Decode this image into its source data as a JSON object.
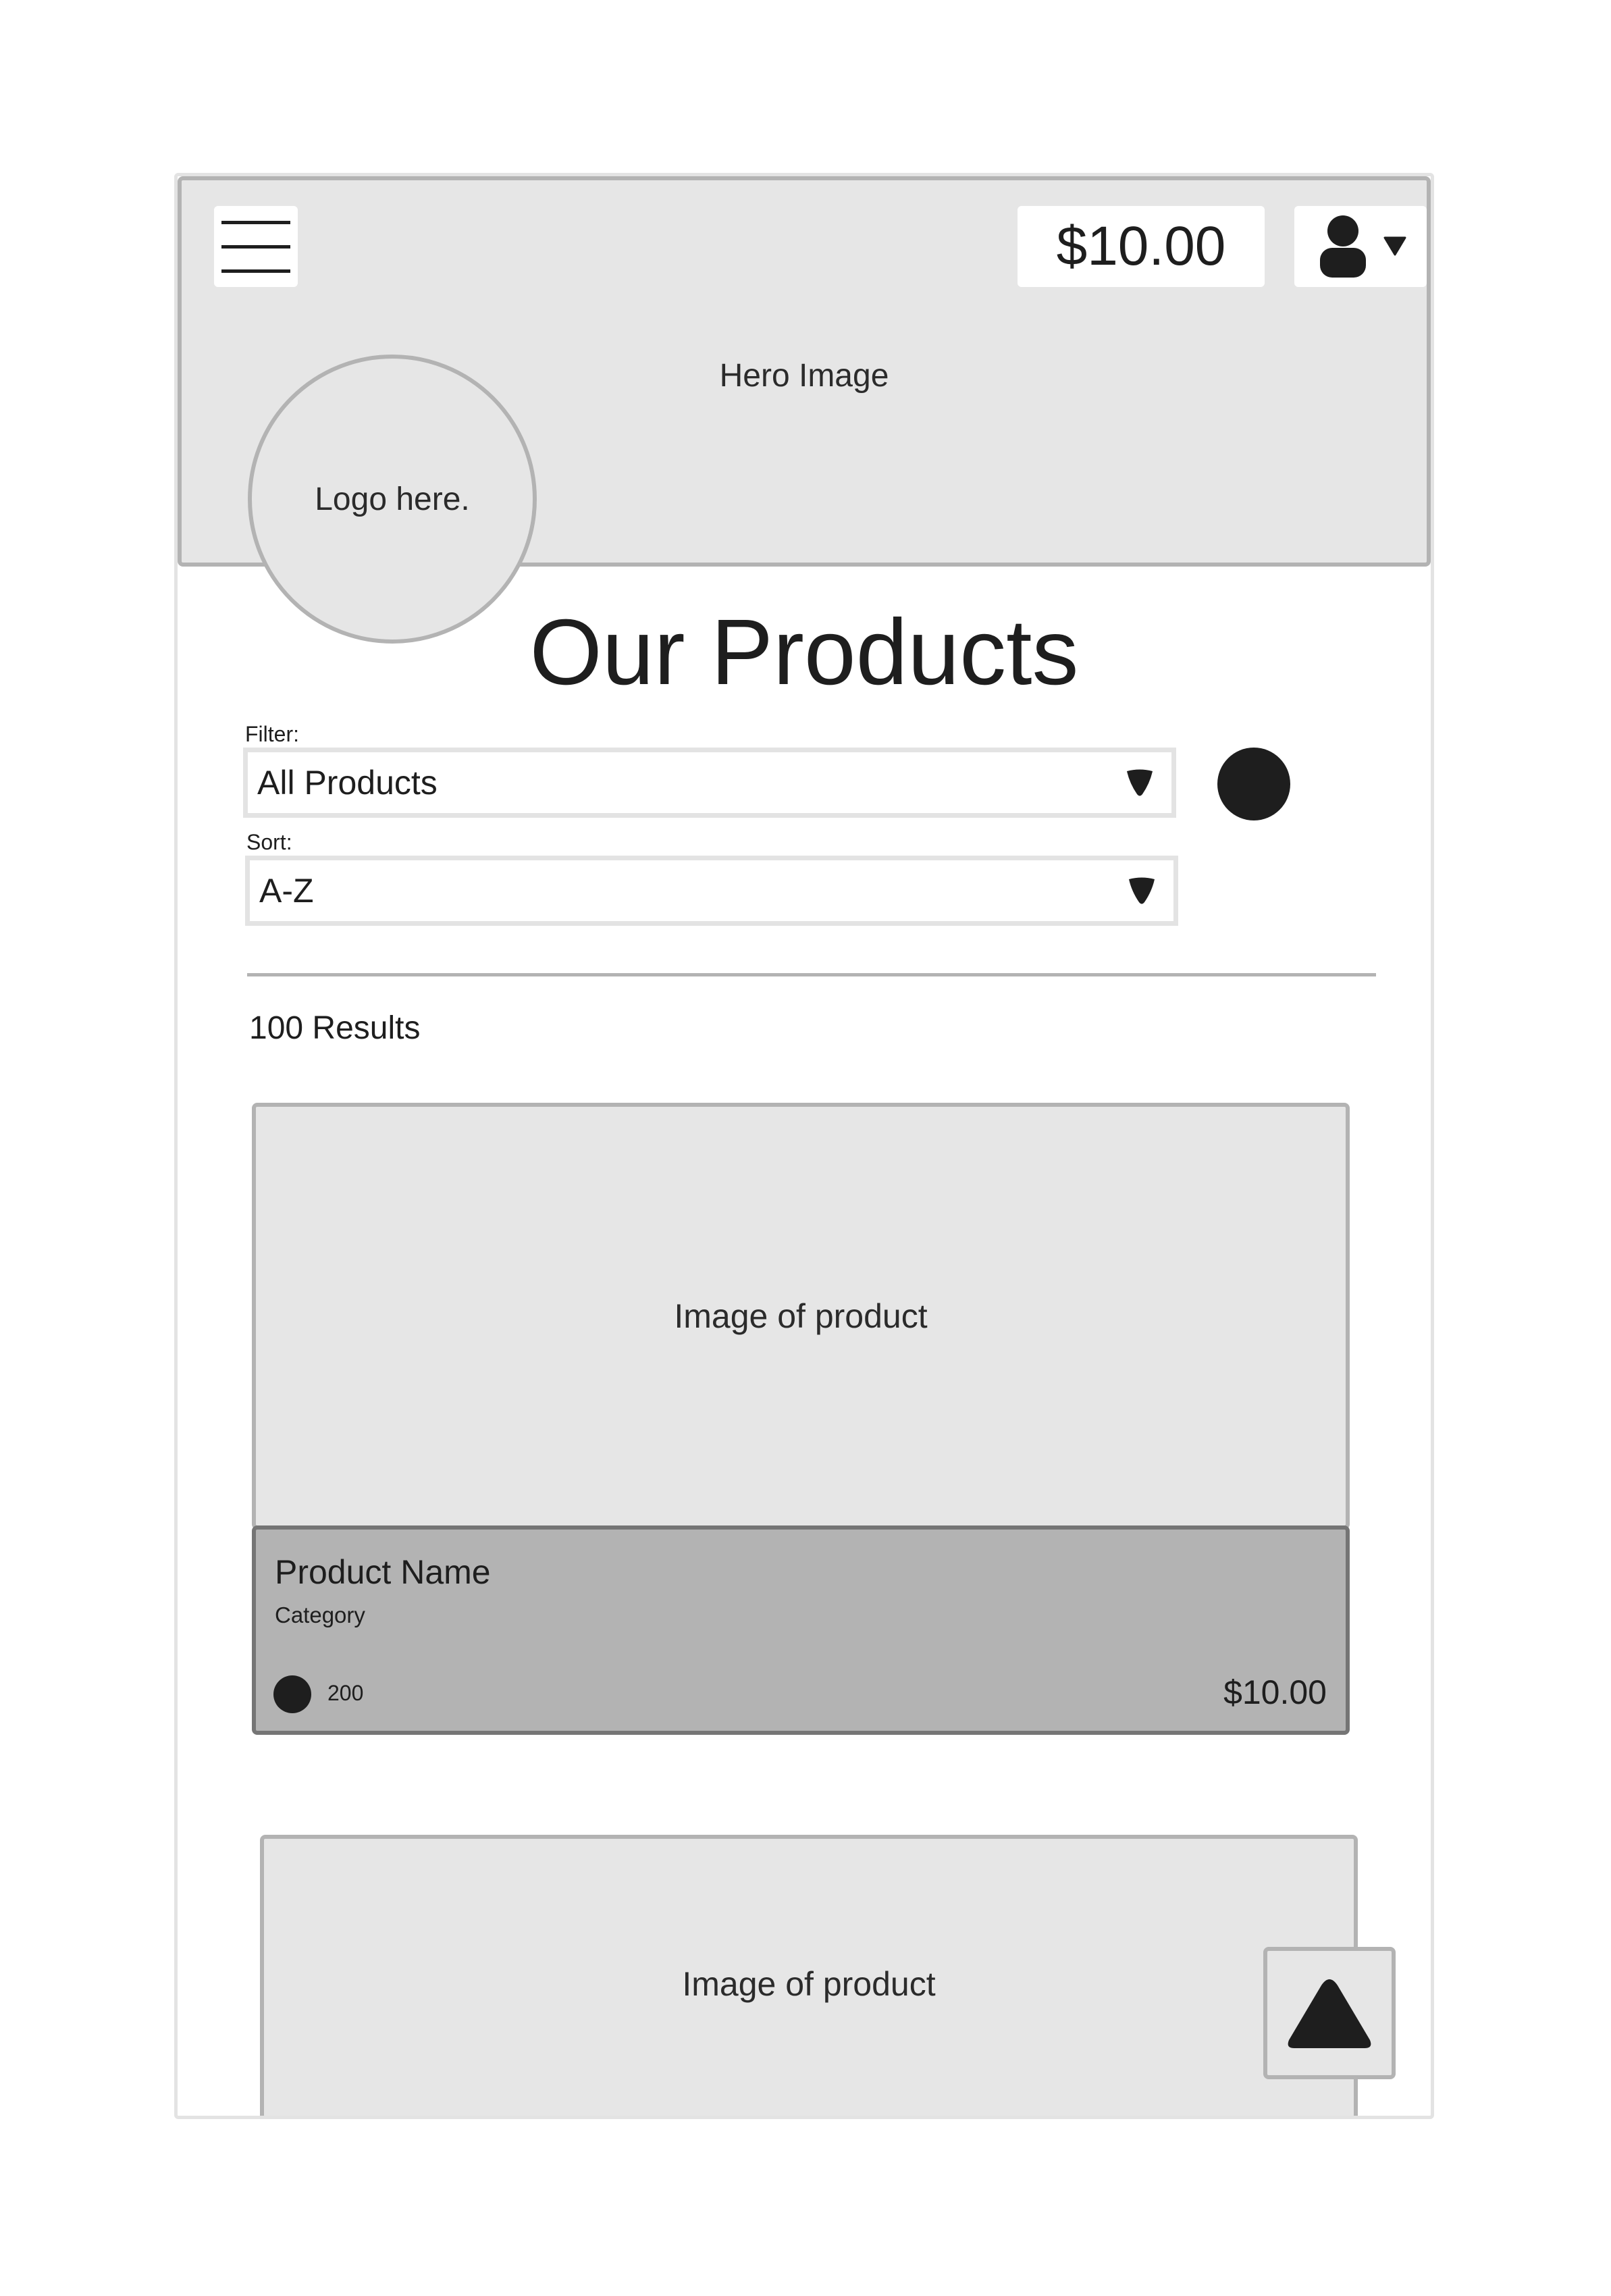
{
  "header": {
    "balance": "$10.00",
    "hero_label": "Hero Image",
    "logo_label": "Logo here.",
    "icons": {
      "menu": "hamburger-menu-icon",
      "account": "user-icon",
      "account_dropdown": "caret-down-icon"
    }
  },
  "main": {
    "title": "Our Products",
    "filter": {
      "label": "Filter:",
      "value": "All Products"
    },
    "sort": {
      "label": "Sort:",
      "value": "A-Z"
    },
    "results_text": "100 Results"
  },
  "products": [
    {
      "image_label": "Image of product",
      "name": "Product Name",
      "category": "Category",
      "rating_count": "200",
      "price": "$10.00"
    },
    {
      "image_label": "Image of product"
    }
  ],
  "colors": {
    "placeholder_fill": "#e6e6e6",
    "placeholder_border": "#b3b3b3",
    "info_fill": "#b3b3b3",
    "dark": "#1e1e1e"
  }
}
